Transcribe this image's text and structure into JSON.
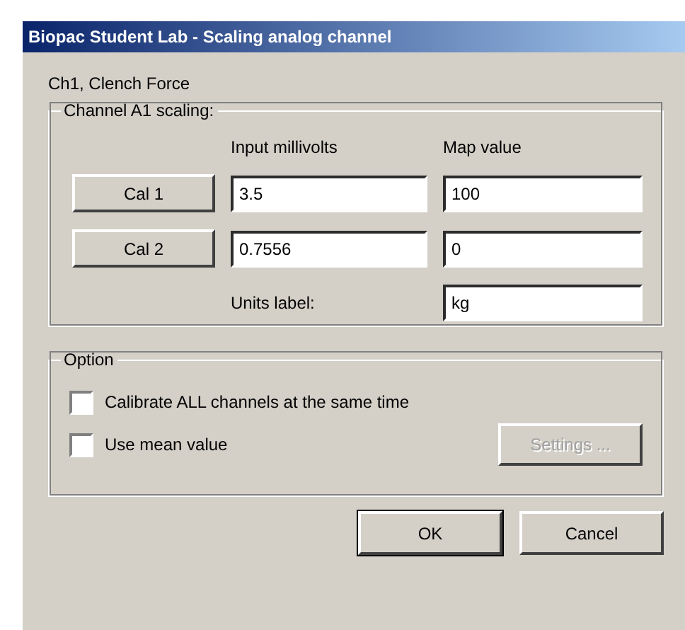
{
  "window": {
    "title": "Biopac Student Lab - Scaling analog channel"
  },
  "channel_label": "Ch1, Clench Force",
  "scaling": {
    "title": "Channel A1 scaling:",
    "column_headers": [
      "Input millivolts",
      "Map value"
    ],
    "rows": [
      {
        "button": {
          "label": "Cal 1"
        },
        "input_millivolts": "3.5",
        "map_value": "100"
      },
      {
        "button": {
          "label": "Cal 2"
        },
        "input_millivolts": "0.7556",
        "map_value": "0"
      }
    ],
    "units": {
      "label": "Units label:",
      "value": "kg"
    }
  },
  "option": {
    "title": "Option",
    "checkboxes": [
      {
        "label": "Calibrate ALL channels at the same time",
        "checked": false
      },
      {
        "label": "Use mean value",
        "checked": false
      }
    ],
    "settings_button": {
      "label": "Settings ...",
      "disabled": true
    }
  },
  "buttons": [
    {
      "label": "OK",
      "default": true
    },
    {
      "label": "Cancel",
      "default": false
    }
  ]
}
